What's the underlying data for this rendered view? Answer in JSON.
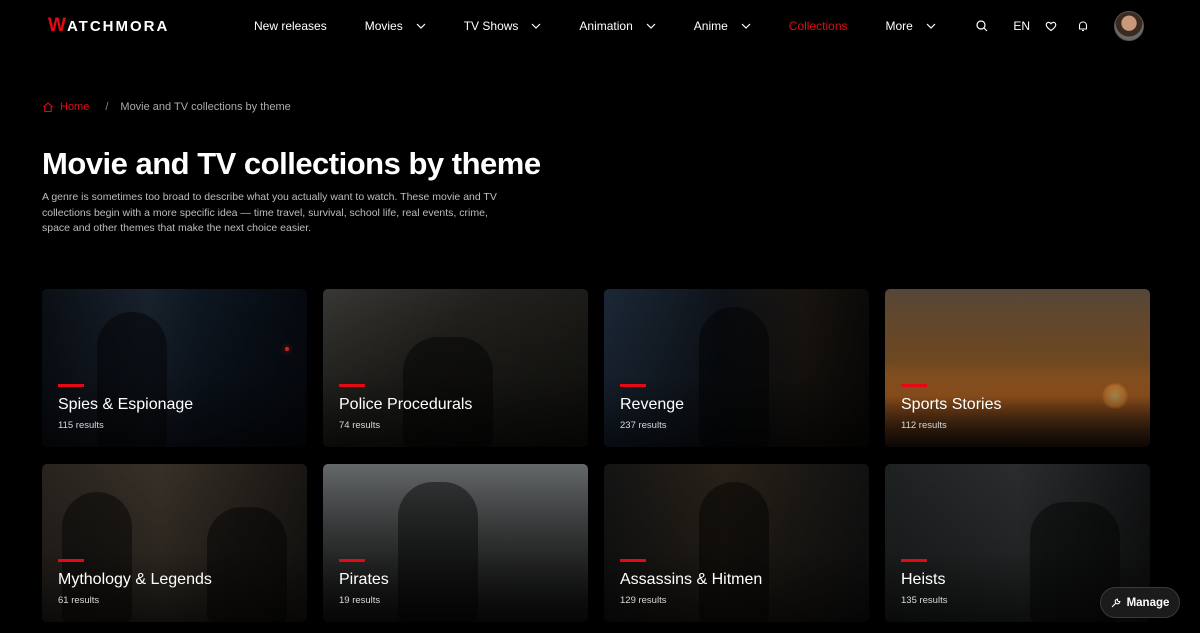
{
  "brand": {
    "logo_first": "W",
    "logo_rest": "ATCHMORA"
  },
  "nav": [
    {
      "label": "New releases",
      "dropdown": false,
      "active": false
    },
    {
      "label": "Movies",
      "dropdown": true,
      "active": false
    },
    {
      "label": "TV Shows",
      "dropdown": true,
      "active": false
    },
    {
      "label": "Animation",
      "dropdown": true,
      "active": false
    },
    {
      "label": "Anime",
      "dropdown": true,
      "active": false
    },
    {
      "label": "Collections",
      "dropdown": false,
      "active": true
    },
    {
      "label": "More",
      "dropdown": true,
      "active": false
    }
  ],
  "header": {
    "language": "EN",
    "icons": [
      "search-icon",
      "heart-icon",
      "bell-icon"
    ]
  },
  "breadcrumb": {
    "home": "Home",
    "separator": "/",
    "current": "Movie and TV collections by theme"
  },
  "page": {
    "title": "Movie and TV collections by theme",
    "description": "A genre is sometimes too broad to describe what you actually want to watch. These movie and TV collections begin with a more specific idea — time travel, survival, school life, real events, crime, space and other themes that make the next choice easier."
  },
  "collections": [
    {
      "title": "Spies & Espionage",
      "count": "115 results"
    },
    {
      "title": "Police Procedurals",
      "count": "74 results"
    },
    {
      "title": "Revenge",
      "count": "237 results"
    },
    {
      "title": "Sports Stories",
      "count": "112 results"
    },
    {
      "title": "Mythology & Legends",
      "count": "61 results"
    },
    {
      "title": "Pirates",
      "count": "19 results"
    },
    {
      "title": "Assassins & Hitmen",
      "count": "129 results"
    },
    {
      "title": "Heists",
      "count": "135 results"
    }
  ],
  "manage": {
    "label": "Manage"
  },
  "colors": {
    "accent": "#e50914",
    "background": "#000000"
  }
}
